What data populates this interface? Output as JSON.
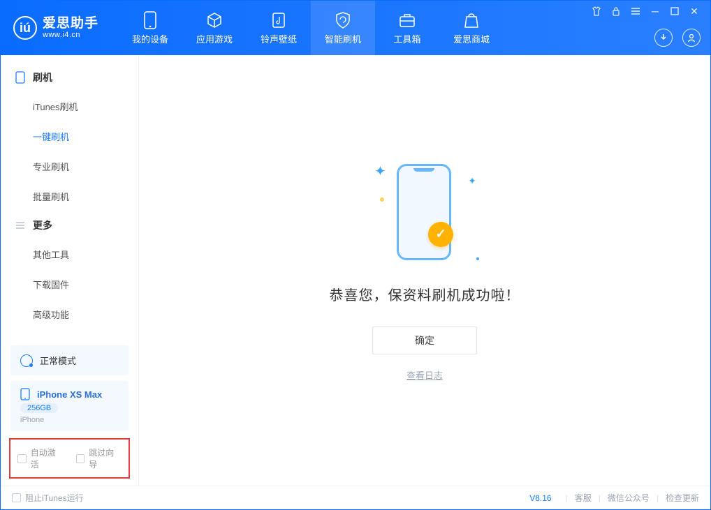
{
  "app": {
    "name": "爱思助手",
    "url": "www.i4.cn"
  },
  "tabs": {
    "device": "我的设备",
    "apps": "应用游戏",
    "ringtone": "铃声壁纸",
    "flash": "智能刷机",
    "toolbox": "工具箱",
    "store": "爱思商城"
  },
  "sidebar": {
    "group1": {
      "title": "刷机",
      "items": [
        "iTunes刷机",
        "一键刷机",
        "专业刷机",
        "批量刷机"
      ]
    },
    "group2": {
      "title": "更多",
      "items": [
        "其他工具",
        "下载固件",
        "高级功能"
      ]
    }
  },
  "mode_card": {
    "label": "正常模式"
  },
  "device": {
    "name": "iPhone XS Max",
    "capacity": "256GB",
    "type": "iPhone"
  },
  "options": {
    "auto_activate": "自动激活",
    "skip_guide": "跳过向导"
  },
  "main": {
    "success_message": "恭喜您，保资料刷机成功啦！",
    "ok_button": "确定",
    "log_link": "查看日志"
  },
  "footer": {
    "block_itunes": "阻止iTunes运行",
    "version": "V8.16",
    "links": [
      "客服",
      "微信公众号",
      "检查更新"
    ]
  }
}
